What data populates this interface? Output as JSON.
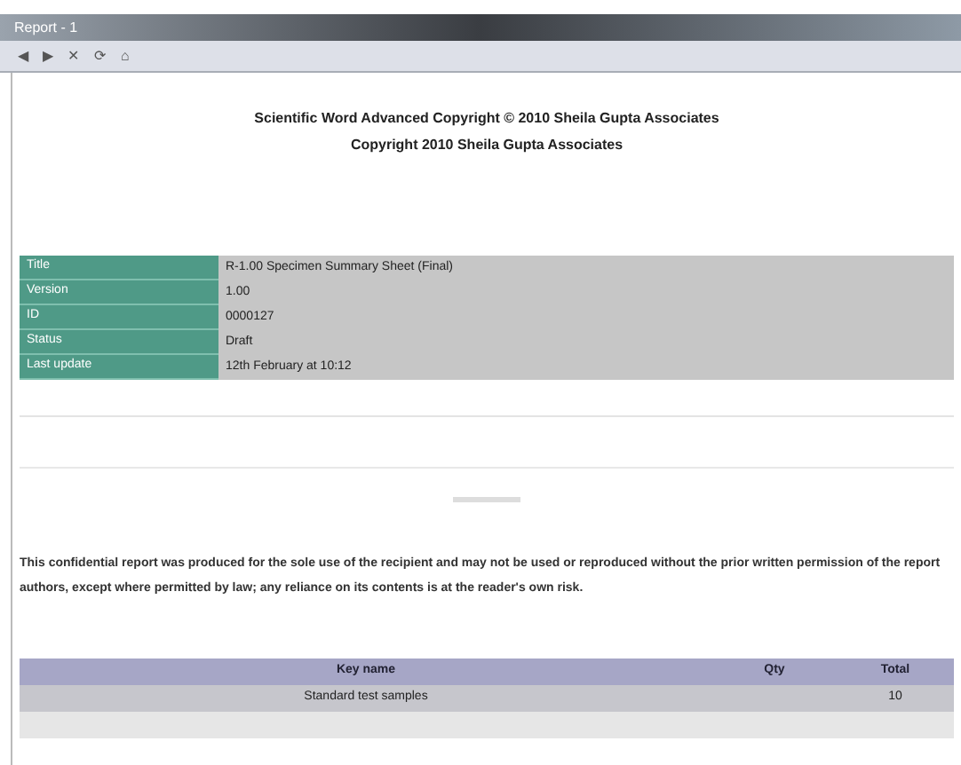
{
  "window": {
    "title": "Report - 1"
  },
  "toolbar": {
    "buttons": [
      "◀",
      "▶",
      "✕",
      "⟳",
      "⌂"
    ]
  },
  "heading": [
    "Scientific Word Advanced Copyright © 2010 Sheila Gupta Associates",
    "Copyright 2010 Sheila Gupta Associates"
  ],
  "info": [
    {
      "label": "Title",
      "value": "R-1.00 Specimen Summary Sheet (Final)"
    },
    {
      "label": "Version",
      "value": "1.00"
    },
    {
      "label": "ID",
      "value": "0000127"
    },
    {
      "label": "Status",
      "value": "Draft"
    },
    {
      "label": "Last update",
      "value": "12th February at 10:12"
    }
  ],
  "paragraph": "This confidential report was produced for the sole use of the recipient and may not be used or reproduced without the prior written permission of the report authors, except where permitted by law; any reliance on its contents is at the reader's own risk.",
  "table": {
    "columns": [
      "Key name",
      "Qty",
      "Total"
    ],
    "rows": [
      [
        "Standard test samples",
        "",
        "10"
      ]
    ]
  }
}
